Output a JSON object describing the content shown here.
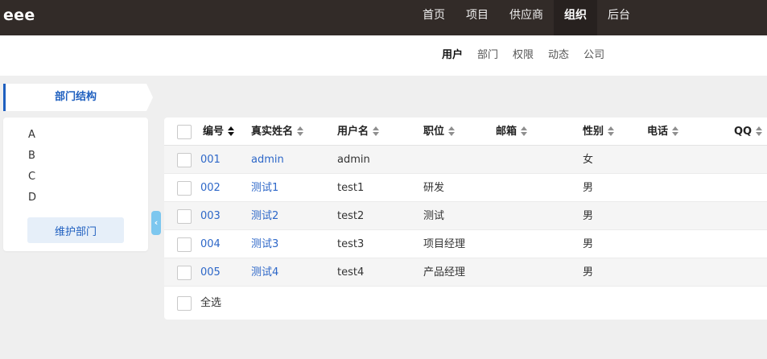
{
  "header": {
    "brand": "eee",
    "nav": [
      {
        "label": "首页",
        "active": false
      },
      {
        "label": "项目",
        "active": false
      },
      {
        "label": "供应商",
        "active": false
      },
      {
        "label": "组织",
        "active": true
      },
      {
        "label": "后台",
        "active": false
      }
    ]
  },
  "subnav": [
    {
      "label": "用户",
      "active": true
    },
    {
      "label": "部门",
      "active": false
    },
    {
      "label": "权限",
      "active": false
    },
    {
      "label": "动态",
      "active": false
    },
    {
      "label": "公司",
      "active": false
    }
  ],
  "sidebar": {
    "title": "部门结构",
    "departments": [
      "A",
      "B",
      "C",
      "D"
    ],
    "maintain_label": "维护部门"
  },
  "table": {
    "columns": [
      {
        "key": "id",
        "label": "编号",
        "sort": "desc"
      },
      {
        "key": "realname",
        "label": "真实姓名",
        "sort": "none"
      },
      {
        "key": "username",
        "label": "用户名",
        "sort": "none"
      },
      {
        "key": "position",
        "label": "职位",
        "sort": "none"
      },
      {
        "key": "email",
        "label": "邮箱",
        "sort": "none"
      },
      {
        "key": "gender",
        "label": "性别",
        "sort": "none"
      },
      {
        "key": "phone",
        "label": "电话",
        "sort": "none"
      },
      {
        "key": "qq",
        "label": "QQ",
        "sort": "none"
      }
    ],
    "rows": [
      {
        "id": "001",
        "realname": "admin",
        "username": "admin",
        "position": "",
        "email": "",
        "gender": "女",
        "phone": "",
        "qq": ""
      },
      {
        "id": "002",
        "realname": "测试1",
        "username": "test1",
        "position": "研发",
        "email": "",
        "gender": "男",
        "phone": "",
        "qq": ""
      },
      {
        "id": "003",
        "realname": "测试2",
        "username": "test2",
        "position": "测试",
        "email": "",
        "gender": "男",
        "phone": "",
        "qq": ""
      },
      {
        "id": "004",
        "realname": "测试3",
        "username": "test3",
        "position": "项目经理",
        "email": "",
        "gender": "男",
        "phone": "",
        "qq": ""
      },
      {
        "id": "005",
        "realname": "测试4",
        "username": "test4",
        "position": "产品经理",
        "email": "",
        "gender": "男",
        "phone": "",
        "qq": ""
      }
    ],
    "select_all_label": "全选"
  },
  "colors": {
    "topbar": "#322b28",
    "accent_blue": "#1e5fbf",
    "link_blue": "#2d67c8",
    "handle_blue": "#7dc7ef"
  },
  "icons": {
    "collapse_handle": "chevron-left-icon",
    "sort": "sort-arrows-icon"
  }
}
